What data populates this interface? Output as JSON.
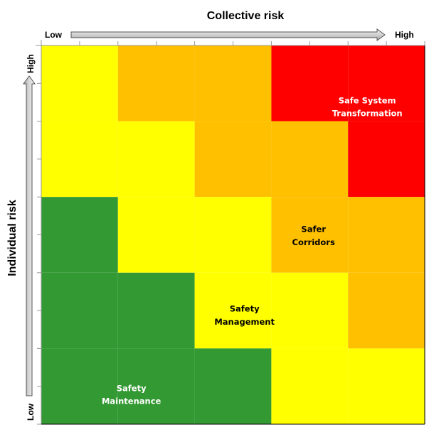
{
  "chart_data": {
    "type": "heatmap",
    "title": "",
    "xlabel": "Collective risk",
    "ylabel": "Individual risk",
    "x_low_label": "Low",
    "x_high_label": "High",
    "y_low_label": "Low",
    "y_high_label": "High",
    "xlim": [
      0,
      10
    ],
    "ylim": [
      0,
      10
    ],
    "x_ticks": [
      0,
      1,
      2,
      3,
      4,
      5,
      6,
      7,
      8,
      9,
      10
    ],
    "y_ticks": [
      0,
      1,
      2,
      3,
      4,
      5,
      6,
      7,
      8,
      9,
      10
    ],
    "grid": false,
    "cell_size": 2,
    "colors": {
      "green": "#339933",
      "yellow": "#FFFF00",
      "orange": "#FFC000",
      "red": "#FF0000"
    },
    "rows_top_to_bottom": [
      [
        "yellow",
        "orange",
        "orange",
        "red",
        "red"
      ],
      [
        "yellow",
        "yellow",
        "orange",
        "orange",
        "red"
      ],
      [
        "green",
        "yellow",
        "yellow",
        "orange",
        "orange"
      ],
      [
        "green",
        "green",
        "yellow",
        "yellow",
        "orange"
      ],
      [
        "green",
        "green",
        "green",
        "yellow",
        "yellow"
      ]
    ],
    "annotations": [
      {
        "lines": [
          "Safe System",
          "Transformation"
        ],
        "x": 8.5,
        "y": 8.4,
        "color": "#FFFFFF"
      },
      {
        "lines": [
          "Safer",
          "Corridors"
        ],
        "x": 7.1,
        "y": 5.0,
        "color": "#000000"
      },
      {
        "lines": [
          "Safety",
          "Management"
        ],
        "x": 5.3,
        "y": 2.9,
        "color": "#000000"
      },
      {
        "lines": [
          "Safety",
          "Maintenance"
        ],
        "x": 2.35,
        "y": 0.8,
        "color": "#FFFFFF"
      }
    ]
  }
}
